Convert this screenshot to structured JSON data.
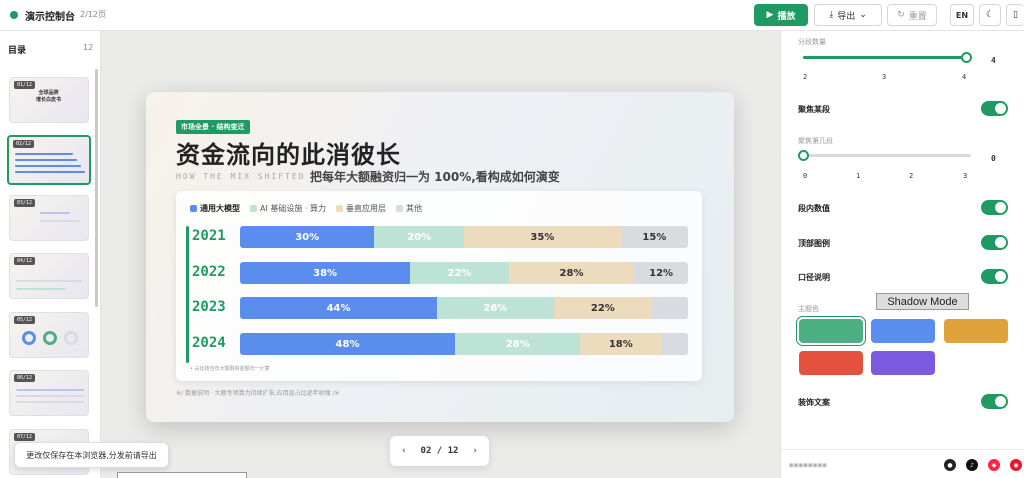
{
  "topbar": {
    "title": "演示控制台",
    "page_count": "2/12页",
    "play_label": "播放",
    "export_label": "导出",
    "reset_label": "重置",
    "lang_label": "EN",
    "accent": "#1f9a63"
  },
  "sidebar": {
    "title": "目录",
    "count": "12",
    "thumbnails": [
      {
        "badge": "01/12",
        "title": "全球品牌\n增长白皮书"
      },
      {
        "badge": "02/12"
      },
      {
        "badge": "03/12"
      },
      {
        "badge": "04/12"
      },
      {
        "badge": "05/12"
      },
      {
        "badge": "06/12"
      },
      {
        "badge": "07/12"
      }
    ]
  },
  "toast": {
    "text": "更改仅保存在本浏览器,分发前请导出"
  },
  "slide": {
    "tag": "市场全景 · 结构变迁",
    "headline": "资金流向的此消彼长",
    "sub_en": "HOW THE MIX SHIFTED",
    "sub_cn": "把每年大额融资归一为 100%,看构成如何演变",
    "legend": [
      "通用大模型",
      "AI 基础设施 · 算力",
      "垂直应用层",
      "其他"
    ],
    "footnote": "• 占比按当年大额融资金额归一计算",
    "footer": "※/ 数据说明 · 大额专项算力持续扩张,应用层占比逐年收缩 /※"
  },
  "chart_data": {
    "type": "bar",
    "stacked": true,
    "orientation": "horizontal",
    "categories": [
      "2021",
      "2022",
      "2023",
      "2024"
    ],
    "series": [
      {
        "name": "通用大模型",
        "values": [
          30,
          38,
          44,
          48
        ],
        "color": "#5b8def"
      },
      {
        "name": "AI 基础设施 · 算力",
        "values": [
          20,
          22,
          26,
          28
        ],
        "color": "#bde3d6"
      },
      {
        "name": "垂直应用层",
        "values": [
          35,
          28,
          22,
          18
        ],
        "color": "#ecdcbd"
      },
      {
        "name": "其他",
        "values": [
          15,
          12,
          8,
          6
        ],
        "color": "#d8dbe0"
      }
    ],
    "value_labels": [
      [
        "30%",
        "20%",
        "35%",
        "15%"
      ],
      [
        "38%",
        "22%",
        "28%",
        "12%"
      ],
      [
        "44%",
        "26%",
        "22%",
        ""
      ],
      [
        "48%",
        "28%",
        "18%",
        ""
      ]
    ],
    "xlim": [
      0,
      100
    ],
    "legend_position": "top-left"
  },
  "pager": {
    "label": "02 / 12"
  },
  "panel": {
    "segment_count_label": "分段数量",
    "segment_count_ticks": [
      "2",
      "3",
      "4"
    ],
    "segment_count_value": "4",
    "segment_count_fraction": 1.0,
    "focus_label": "聚焦某段",
    "focus_on": true,
    "focus_index_label": "聚焦第几段",
    "focus_index_ticks": [
      "0",
      "1",
      "2",
      "3"
    ],
    "focus_index_value": "0",
    "focus_index_fraction": 0.0,
    "inner_values_label": "段内数值",
    "inner_values_on": true,
    "top_legend_label": "顶部图例",
    "top_legend_on": true,
    "caliber_label": "口径说明",
    "caliber_on": true,
    "theme_label": "主题色",
    "theme_colors": [
      "#4daf84",
      "#5b8def",
      "#e0a23a",
      "#e4523f",
      "#7b5ae0"
    ],
    "theme_selected": 0,
    "decor_label": "装饰文案",
    "decor_on": true,
    "shadow_mode": "Shadow Mode",
    "social_icons": [
      "github-icon",
      "tiktok-icon",
      "xiaohongshu-icon",
      "weibo-icon"
    ]
  }
}
